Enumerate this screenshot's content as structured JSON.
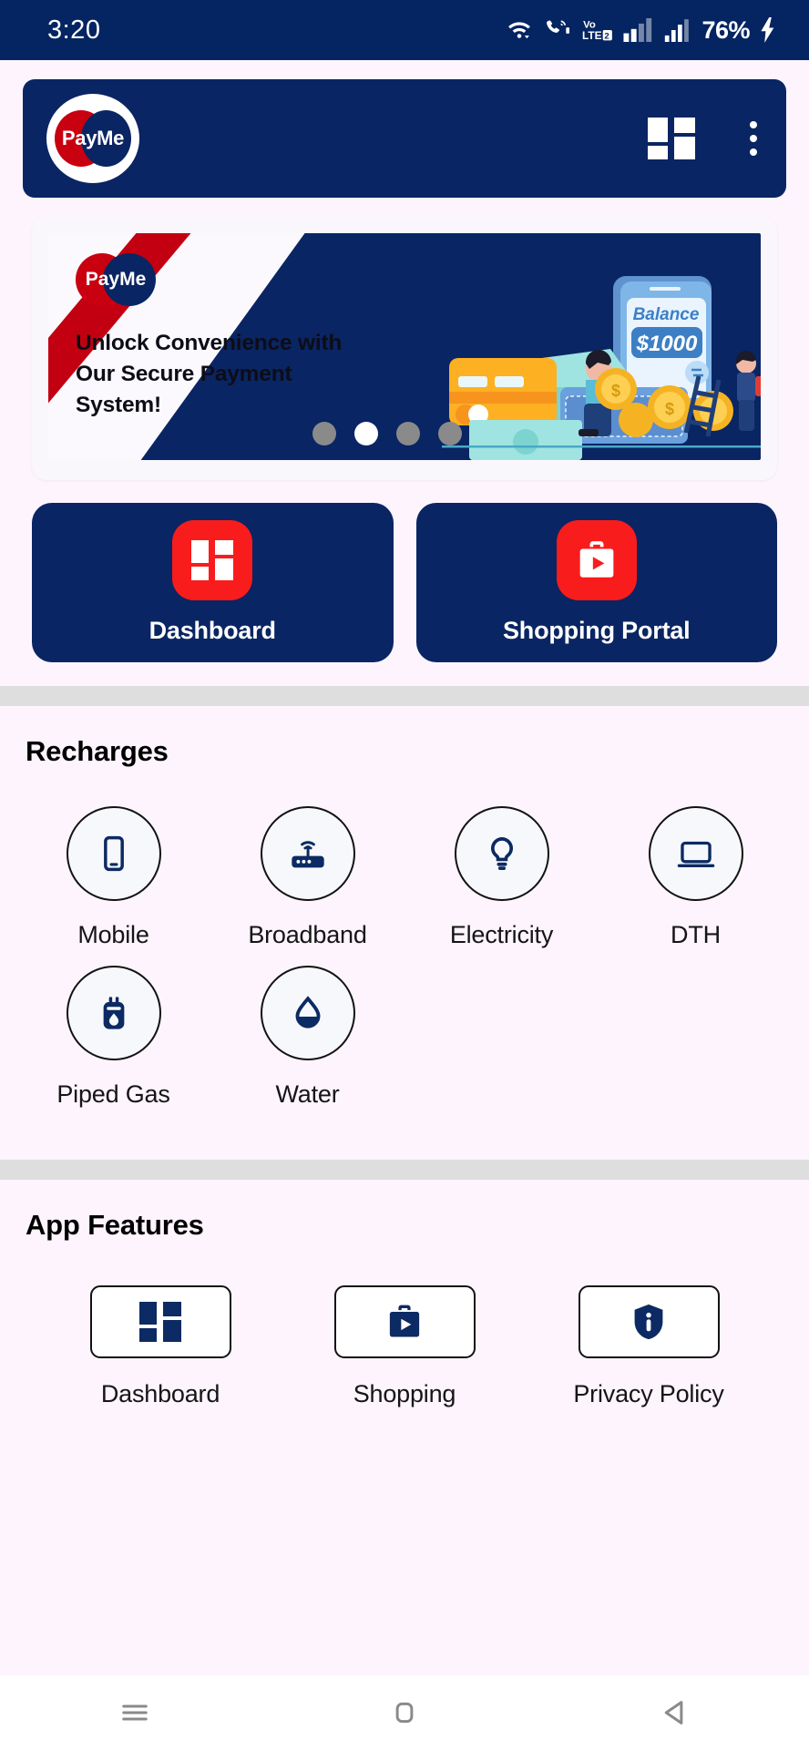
{
  "status_bar": {
    "time": "3:20",
    "battery": "76%",
    "icons": [
      "wifi-icon",
      "call-wifi-icon",
      "volte2-icon",
      "signal-bars-sim1-icon",
      "signal-bars-sim2-icon",
      "charging-bolt-icon"
    ]
  },
  "app_bar": {
    "logo_text": "PayMe",
    "grid_icon": "dashboard-grid-icon",
    "menu_icon": "overflow-menu-icon"
  },
  "banner": {
    "logo_text": "PayMe",
    "headline": "Unlock Convenience with Our Secure Payment System!",
    "illustration": {
      "phone_label": "Balance",
      "phone_amount": "$1000",
      "coin_symbol": "$"
    },
    "carousel": {
      "total": 4,
      "active_index": 1
    }
  },
  "actions": [
    {
      "label": "Dashboard",
      "icon": "dashboard-grid-icon"
    },
    {
      "label": "Shopping Portal",
      "icon": "shopping-bag-play-icon"
    }
  ],
  "recharges": {
    "title": "Recharges",
    "items": [
      {
        "label": "Mobile",
        "icon": "mobile-phone-icon"
      },
      {
        "label": "Broadband",
        "icon": "router-wifi-icon"
      },
      {
        "label": "Electricity",
        "icon": "lightbulb-icon"
      },
      {
        "label": "DTH",
        "icon": "monitor-icon"
      },
      {
        "label": "Piped Gas",
        "icon": "gas-canister-icon"
      },
      {
        "label": "Water",
        "icon": "water-drop-icon"
      }
    ]
  },
  "app_features": {
    "title": "App Features",
    "items": [
      {
        "label": "Dashboard",
        "icon": "dashboard-grid-icon"
      },
      {
        "label": "Shopping",
        "icon": "shopping-bag-play-icon"
      },
      {
        "label": "Privacy Policy",
        "icon": "shield-info-icon"
      }
    ]
  },
  "nav_bar": {
    "items": [
      {
        "name": "recents-button",
        "icon": "hamburger-icon"
      },
      {
        "name": "home-button",
        "icon": "rounded-square-icon"
      },
      {
        "name": "back-button",
        "icon": "triangle-left-icon"
      }
    ]
  },
  "colors": {
    "navy": "#0a2563",
    "red": "#f91c1c",
    "brand_red": "#c80010",
    "page_bg": "#fdf4fd",
    "divider": "#dedede"
  }
}
